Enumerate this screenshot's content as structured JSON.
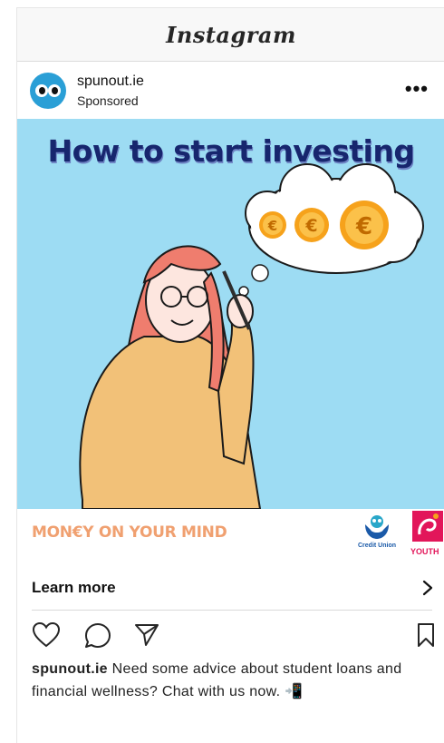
{
  "topbar": {
    "brand": "Instagram"
  },
  "post": {
    "username": "spunout.ie",
    "sponsored": "Sponsored",
    "more_label": "•••"
  },
  "creative": {
    "headline": "How to start investing",
    "tagline": "MON€Y ON YOUR MIND",
    "coin_symbol": "€",
    "logos": {
      "credit_union": "Credit Union",
      "youth": "YOUTH"
    }
  },
  "cta": {
    "label": "Learn more"
  },
  "caption": {
    "username": "spunout.ie",
    "text": " Need some advice about student loans and financial wellness? Chat with us now. 📲"
  },
  "colors": {
    "sky": "#9ddcf3",
    "headline": "#17266e",
    "coin": "#f6a21b",
    "hair": "#ef7d6e",
    "sweater": "#f2c178",
    "tagline": "#f0a070"
  }
}
